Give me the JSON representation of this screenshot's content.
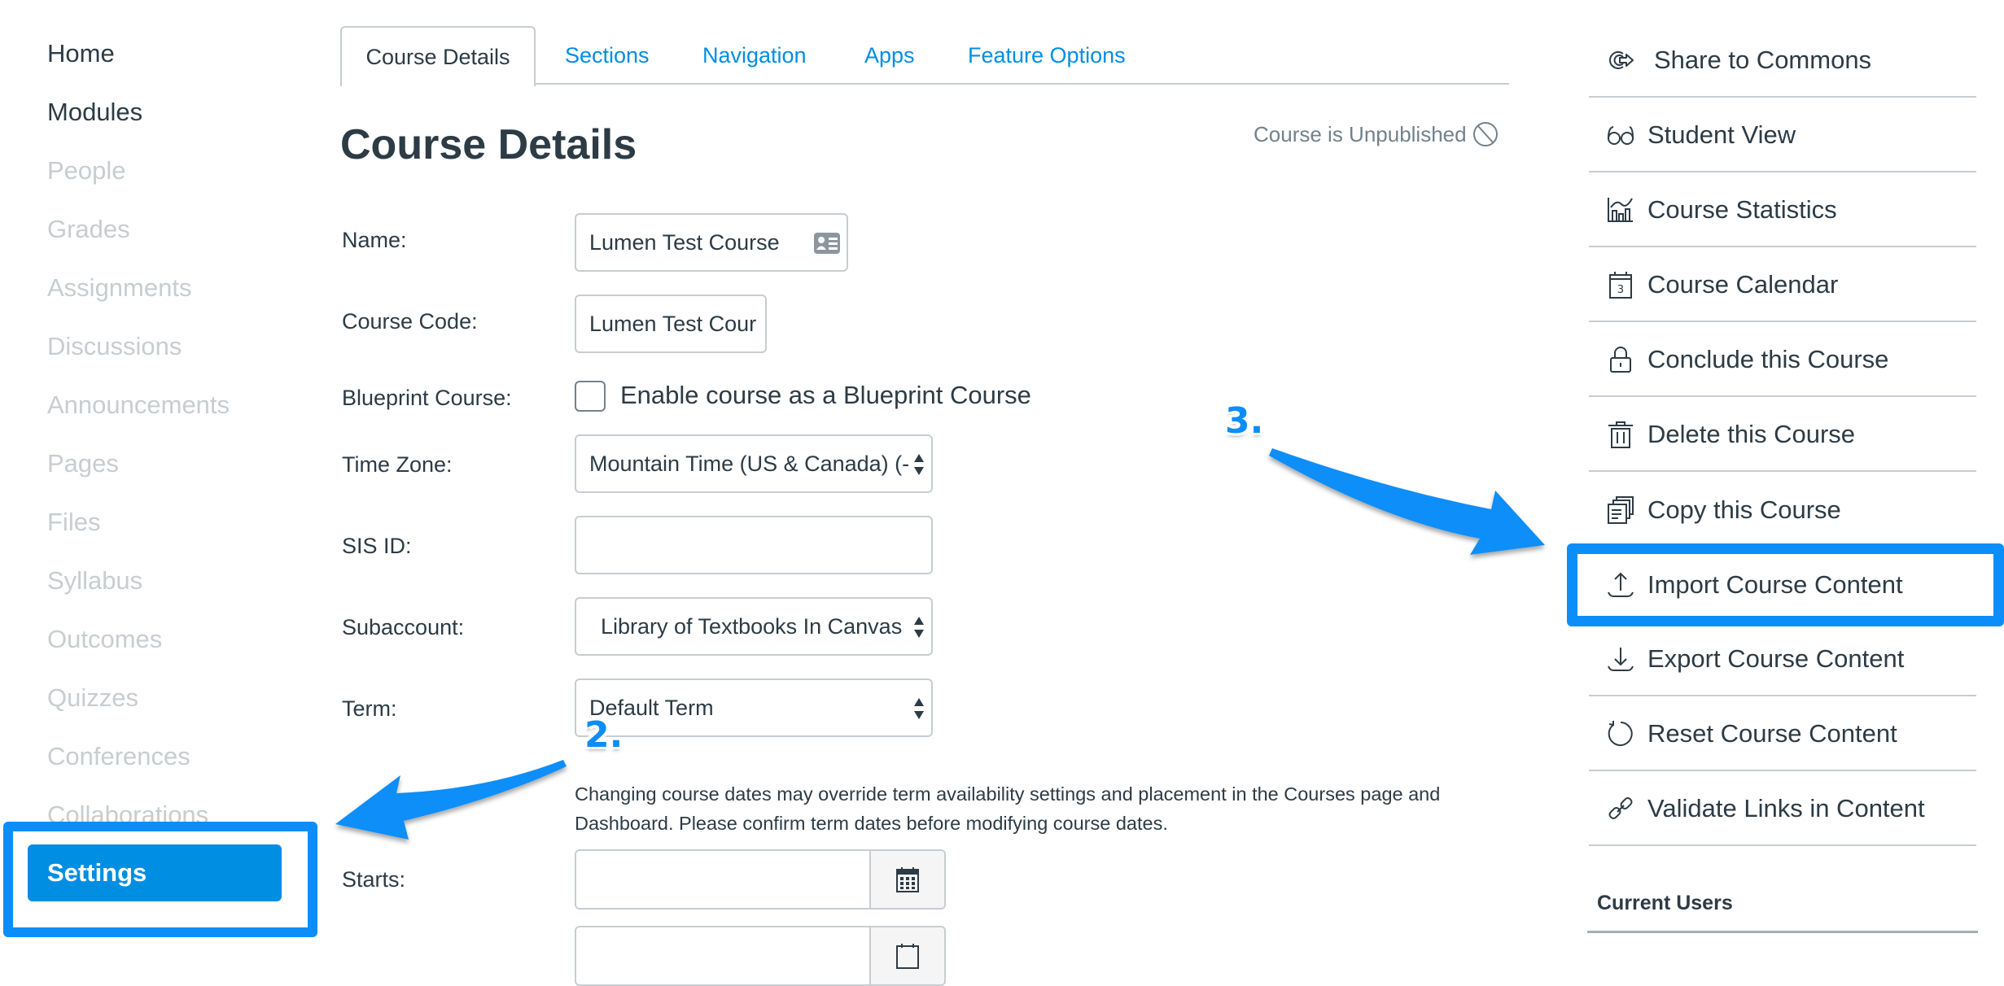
{
  "course_nav": {
    "items": [
      {
        "label": "Home",
        "state": "enabled"
      },
      {
        "label": "Modules",
        "state": "enabled"
      },
      {
        "label": "People",
        "state": "disabled"
      },
      {
        "label": "Grades",
        "state": "disabled"
      },
      {
        "label": "Assignments",
        "state": "disabled"
      },
      {
        "label": "Discussions",
        "state": "disabled"
      },
      {
        "label": "Announcements",
        "state": "disabled"
      },
      {
        "label": "Pages",
        "state": "disabled"
      },
      {
        "label": "Files",
        "state": "disabled"
      },
      {
        "label": "Syllabus",
        "state": "disabled"
      },
      {
        "label": "Outcomes",
        "state": "disabled"
      },
      {
        "label": "Quizzes",
        "state": "disabled"
      },
      {
        "label": "Conferences",
        "state": "disabled"
      },
      {
        "label": "Collaborations",
        "state": "disabled"
      }
    ],
    "settings_label": "Settings"
  },
  "tabs": [
    {
      "label": "Course Details",
      "active": true
    },
    {
      "label": "Sections",
      "active": false
    },
    {
      "label": "Navigation",
      "active": false
    },
    {
      "label": "Apps",
      "active": false
    },
    {
      "label": "Feature Options",
      "active": false
    }
  ],
  "header": {
    "title": "Course Details",
    "publish_status": "Course is Unpublished",
    "publish_icon": "unpublished-circle-slash-icon"
  },
  "form": {
    "name": {
      "label": "Name:",
      "value": "Lumen Test Course",
      "icon": "contact-card-icon"
    },
    "course_code": {
      "label": "Course Code:",
      "value": "Lumen Test Cour"
    },
    "blueprint": {
      "label": "Blueprint Course:",
      "checkbox_label": "Enable course as a Blueprint Course",
      "checked": false
    },
    "time_zone": {
      "label": "Time Zone:",
      "value": "Mountain Time (US & Canada) (-"
    },
    "sis_id": {
      "label": "SIS ID:",
      "value": ""
    },
    "subaccount": {
      "label": "Subaccount:",
      "value": "Library of Textbooks In Canvas"
    },
    "term": {
      "label": "Term:",
      "value": "Default Term"
    },
    "dates_notice": "Changing course dates may override term availability settings and placement in the Courses page and Dashboard. Please confirm term dates before modifying course dates.",
    "starts": {
      "label": "Starts:",
      "value": "",
      "icon": "calendar-icon"
    },
    "ends": {
      "value": "",
      "icon": "calendar-icon"
    }
  },
  "sidebar_actions": [
    {
      "label": "Share to Commons",
      "icon": "commons-share-icon"
    },
    {
      "label": "Student View",
      "icon": "glasses-icon"
    },
    {
      "label": "Course Statistics",
      "icon": "statistics-icon"
    },
    {
      "label": "Course Calendar",
      "icon": "calendar-icon"
    },
    {
      "label": "Conclude this Course",
      "icon": "lock-icon"
    },
    {
      "label": "Delete this Course",
      "icon": "trash-icon"
    },
    {
      "label": "Copy this Course",
      "icon": "copy-icon"
    },
    {
      "label": "Import Course Content",
      "icon": "upload-icon",
      "highlighted": true
    },
    {
      "label": "Export Course Content",
      "icon": "download-icon"
    },
    {
      "label": "Reset Course Content",
      "icon": "reset-icon"
    },
    {
      "label": "Validate Links in Content",
      "icon": "link-icon"
    }
  ],
  "current_users_heading": "Current Users",
  "annotations": {
    "step2": "2.",
    "step3": "3.",
    "color": "#0b8ef9"
  },
  "colors": {
    "link_blue": "#008ee2",
    "text_dark": "#2d3b45",
    "disabled_gray": "#c7cdd1"
  }
}
